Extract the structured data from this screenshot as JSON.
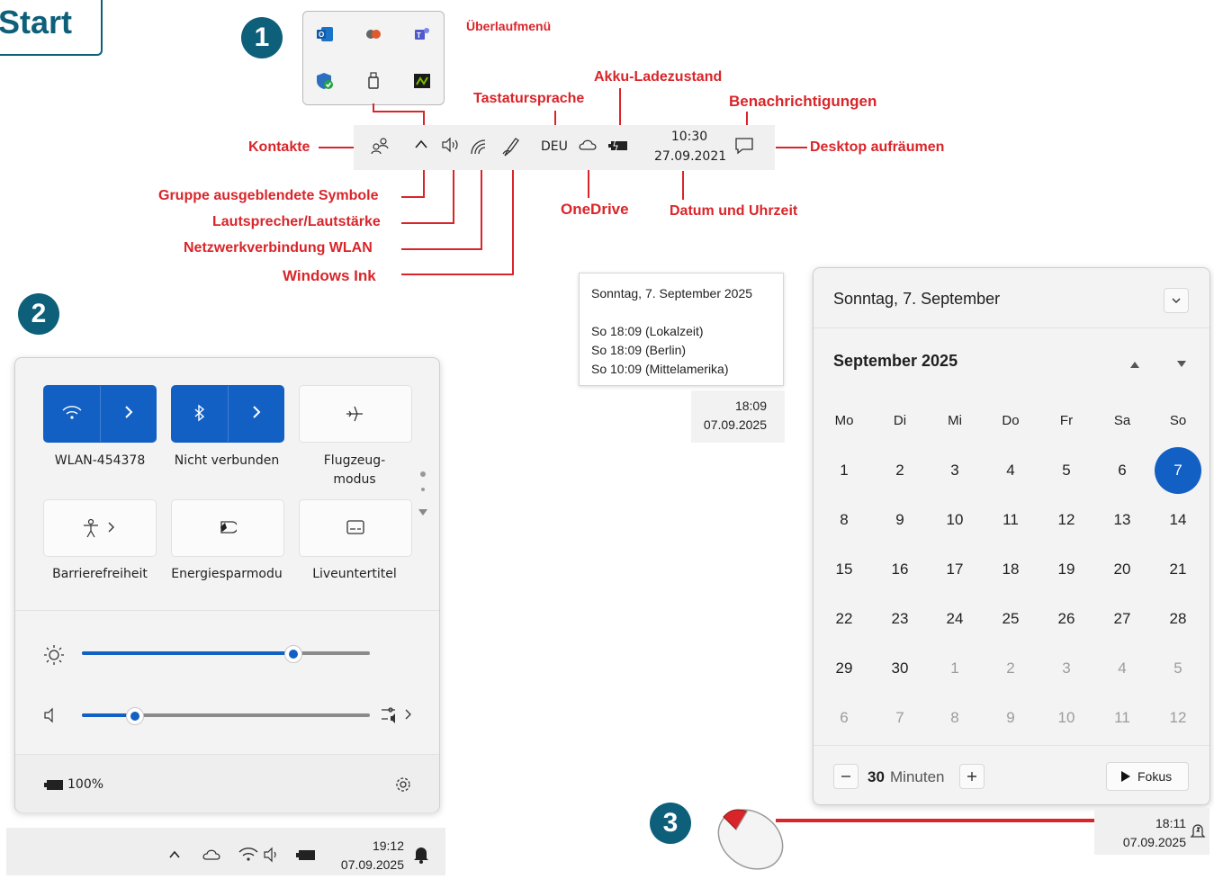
{
  "markers": {
    "start": "Start",
    "one": "1",
    "two": "2",
    "three": "3"
  },
  "annotations": {
    "ueberlauf": "Überlaufmenü",
    "akku": "Akku-Ladezustand",
    "tastatur": "Tastatursprache",
    "benach": "Benachrichtigungen",
    "kontakte": "Kontakte",
    "desktop": "Desktop aufräumen",
    "gruppe": "Gruppe ausgeblendete Symbole",
    "lautsprecher": "Lautsprecher/Lautstärke",
    "netzwerk": "Netzwerkverbindung WLAN",
    "ink": "Windows Ink",
    "onedrive": "OneDrive",
    "datum": "Datum und Uhrzeit"
  },
  "taskbar_top": {
    "lang": "DEU",
    "time": "10:30",
    "date": "27.09.2021"
  },
  "clock_tooltip": {
    "heading": "Sonntag, 7. September 2025",
    "rows": [
      "So 18:09 (Lokalzeit)",
      "So 18:09 (Berlin)",
      "So 10:09 (Mittelamerika)"
    ],
    "time": "18:09",
    "date": "07.09.2025"
  },
  "quick_settings": {
    "tiles": [
      {
        "label": "WLAN-454378"
      },
      {
        "label": "Nicht verbunden"
      },
      {
        "label": "Flugzeug-\nmodus"
      },
      {
        "label": "Barrierefreiheit"
      },
      {
        "label": "Energiesparmodu"
      },
      {
        "label": "Liveuntertitel"
      }
    ],
    "brightness": 0.73,
    "volume": 0.18,
    "battery": "100%"
  },
  "taskbar_bottom": {
    "time": "19:12",
    "date": "07.09.2025"
  },
  "calendar": {
    "header": "Sonntag, 7. September",
    "month": "September 2025",
    "weekdays": [
      "Mo",
      "Di",
      "Mi",
      "Do",
      "Fr",
      "Sa",
      "So"
    ],
    "days": [
      [
        "1",
        "2",
        "3",
        "4",
        "5",
        "6",
        "7"
      ],
      [
        "8",
        "9",
        "10",
        "11",
        "12",
        "13",
        "14"
      ],
      [
        "15",
        "16",
        "17",
        "18",
        "19",
        "20",
        "21"
      ],
      [
        "22",
        "23",
        "24",
        "25",
        "26",
        "27",
        "28"
      ],
      [
        "29",
        "30",
        "1",
        "2",
        "3",
        "4",
        "5"
      ],
      [
        "6",
        "7",
        "8",
        "9",
        "10",
        "11",
        "12"
      ]
    ],
    "focus_value": "30",
    "focus_unit": "Minuten",
    "focus_button": "Fokus"
  },
  "bottom_clock": {
    "time": "18:11",
    "date": "07.09.2025"
  },
  "colors": {
    "annotation": "#d9252a",
    "accent": "#1360c4",
    "marker": "#0d5f7a"
  }
}
